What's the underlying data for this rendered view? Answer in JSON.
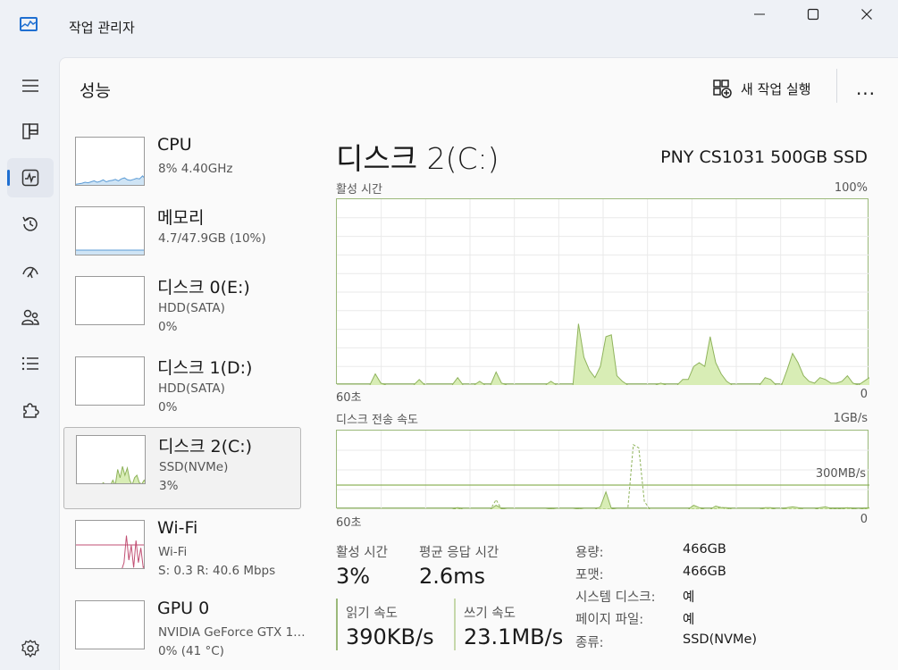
{
  "window": {
    "title": "작업 관리자",
    "minimize_icon": "minimize-icon",
    "maximize_icon": "maximize-icon",
    "close_icon": "close-icon"
  },
  "nav": {
    "items": [
      {
        "name": "hamburger-menu",
        "icon": "menu-icon"
      },
      {
        "name": "processes",
        "icon": "grid-icon"
      },
      {
        "name": "performance",
        "icon": "activity-icon",
        "active": true
      },
      {
        "name": "app-history",
        "icon": "history-icon"
      },
      {
        "name": "startup-apps",
        "icon": "speedometer-icon"
      },
      {
        "name": "users",
        "icon": "users-icon"
      },
      {
        "name": "details",
        "icon": "list-icon"
      },
      {
        "name": "services",
        "icon": "puzzle-icon"
      },
      {
        "name": "settings",
        "icon": "gear-icon"
      }
    ]
  },
  "header": {
    "title": "성능",
    "run_task_label": "새 작업 실행",
    "more_label": "..."
  },
  "devices": [
    {
      "name": "CPU",
      "line1": "8% 4.40GHz",
      "line2": "",
      "selected": false
    },
    {
      "name": "메모리",
      "line1": "4.7/47.9GB (10%)",
      "line2": "",
      "selected": false
    },
    {
      "name": "디스크 0(E:)",
      "line1": "HDD(SATA)",
      "line2": "0%",
      "selected": false
    },
    {
      "name": "디스크 1(D:)",
      "line1": "HDD(SATA)",
      "line2": "0%",
      "selected": false
    },
    {
      "name": "디스크 2(C:)",
      "line1": "SSD(NVMe)",
      "line2": "3%",
      "selected": true
    },
    {
      "name": "Wi-Fi",
      "line1": "Wi-Fi",
      "line2": "S: 0.3  R: 40.6 Mbps",
      "selected": false
    },
    {
      "name": "GPU 0",
      "line1": "NVIDIA GeForce GTX 1…",
      "line2": "0% (41 °C)",
      "selected": false
    }
  ],
  "detail": {
    "title": "디스크 2(C:)",
    "model": "PNY CS1031 500GB SSD",
    "active_time_graph": {
      "label": "활성 시간",
      "max_label": "100%",
      "left_label": "60초",
      "right_label": "0"
    },
    "transfer_graph": {
      "label": "디스크 전송 속도",
      "max_label": "1GB/s",
      "ref_label": "300MB/s",
      "left_label": "60초",
      "right_label": "0"
    },
    "stats": {
      "active_time_label": "활성 시간",
      "active_time_value": "3%",
      "avg_response_label": "평균 응답 시간",
      "avg_response_value": "2.6ms",
      "read_label": "읽기 속도",
      "read_value": "390KB/s",
      "write_label": "쓰기 속도",
      "write_value": "23.1MB/s"
    },
    "properties": [
      {
        "key": "용량:",
        "value": "466GB"
      },
      {
        "key": "포맷:",
        "value": "466GB"
      },
      {
        "key": "시스템 디스크:",
        "value": "예"
      },
      {
        "key": "페이지 파일:",
        "value": "예"
      },
      {
        "key": "종류:",
        "value": "SSD(NVMe)"
      }
    ]
  },
  "colors": {
    "disk_line": "#8fb35c",
    "disk_fill": "#d8edb5",
    "cpu_line": "#5b9bd5",
    "cpu_fill": "#cfe4f5",
    "wifi_line": "#c14f73",
    "accent": "#1f6fd1"
  }
}
